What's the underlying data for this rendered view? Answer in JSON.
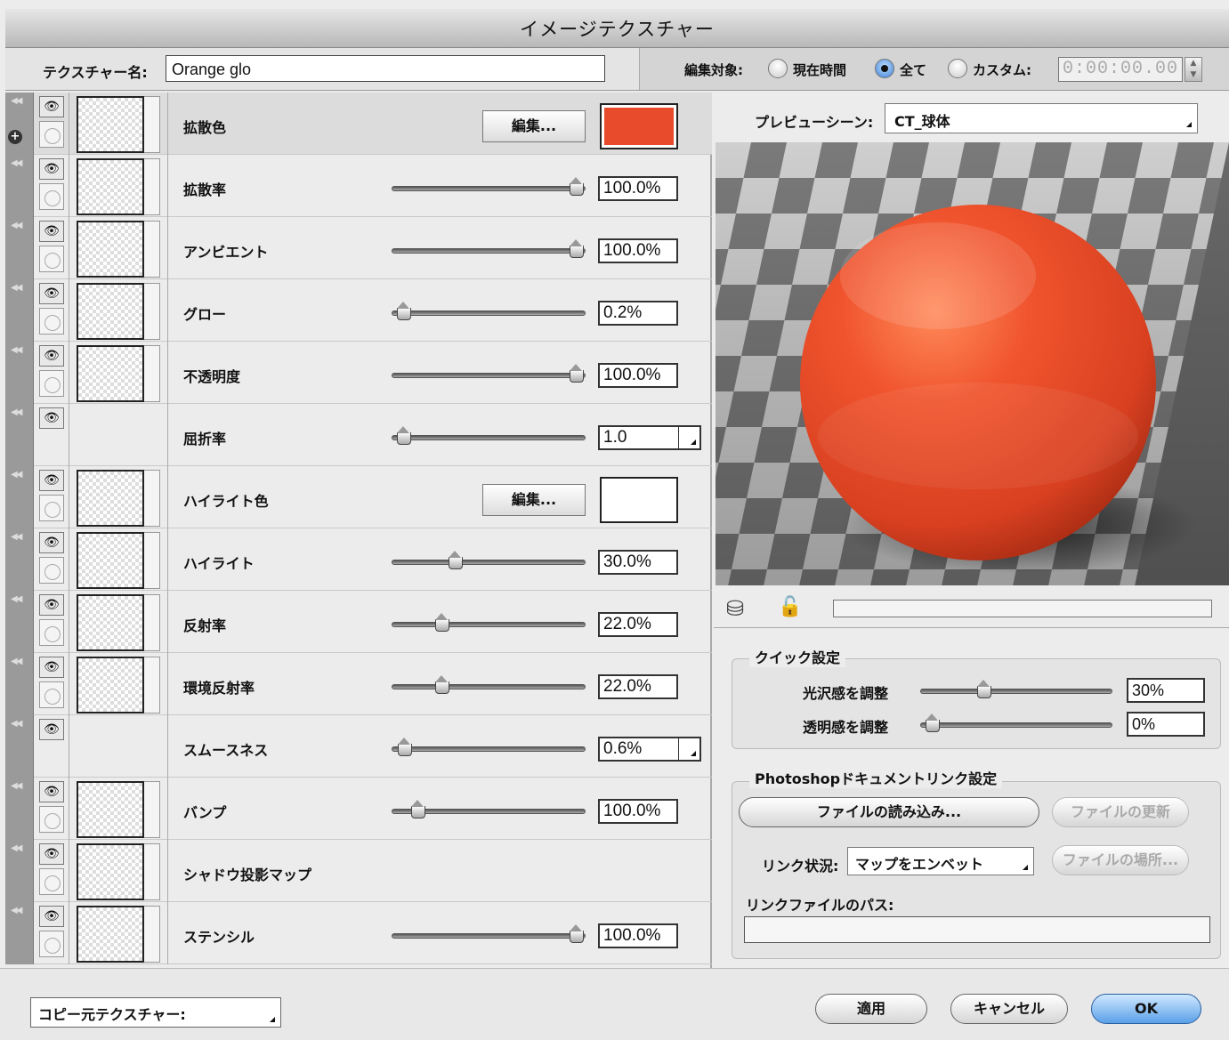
{
  "window": {
    "title": "イメージテクスチャー"
  },
  "texture": {
    "name_label": "テクスチャー名:",
    "name_value": "Orange glo"
  },
  "edit_target": {
    "label": "編集対象:",
    "options": [
      "現在時間",
      "全て",
      "カスタム:"
    ],
    "selected": "全て",
    "time": "0:00:00.00"
  },
  "channels": [
    {
      "label": "拡散色",
      "control": "color",
      "button": "編集...",
      "color": "#e84a2c"
    },
    {
      "label": "拡散率",
      "control": "slider",
      "value": "100.0%",
      "level": 1.0
    },
    {
      "label": "アンビエント",
      "control": "slider",
      "value": "100.0%",
      "level": 1.0
    },
    {
      "label": "グロー",
      "control": "slider",
      "value": "0.2%",
      "level": 0.002
    },
    {
      "label": "不透明度",
      "control": "slider",
      "value": "100.0%",
      "level": 1.0
    },
    {
      "label": "屈折率",
      "control": "slider-dropdown",
      "value": "1.0",
      "level": 0.0
    },
    {
      "label": "ハイライト色",
      "control": "color",
      "button": "編集...",
      "color": "#ffffff"
    },
    {
      "label": "ハイライト",
      "control": "slider",
      "value": "30.0%",
      "level": 0.3
    },
    {
      "label": "反射率",
      "control": "slider",
      "value": "22.0%",
      "level": 0.22
    },
    {
      "label": "環境反射率",
      "control": "slider",
      "value": "22.0%",
      "level": 0.22
    },
    {
      "label": "スムースネス",
      "control": "slider-dropdown",
      "value": "0.6%",
      "level": 0.006
    },
    {
      "label": "バンプ",
      "control": "slider",
      "value": "100.0%",
      "level": 0.08
    },
    {
      "label": "シャドウ投影マップ",
      "control": "none"
    },
    {
      "label": "ステンシル",
      "control": "slider",
      "value": "100.0%",
      "level": 1.0
    }
  ],
  "preview": {
    "scene_label": "プレビューシーン:",
    "scene_value": "CT_球体"
  },
  "quick": {
    "title": "クイック設定",
    "gloss_label": "光沢感を調整",
    "gloss_value": "30%",
    "gloss_level": 0.3,
    "trans_label": "透明感を調整",
    "trans_value": "0%",
    "trans_level": 0.0
  },
  "link": {
    "title": "Photoshopドキュメントリンク設定",
    "load": "ファイルの読み込み...",
    "update": "ファイルの更新",
    "status_label": "リンク状況:",
    "status_value": "マップをエンベット",
    "locate": "ファイルの場所...",
    "path_label": "リンクファイルのパス:"
  },
  "footer": {
    "copy_from": "コピー元テクスチャー:",
    "apply": "適用",
    "cancel": "キャンセル",
    "ok": "OK"
  }
}
